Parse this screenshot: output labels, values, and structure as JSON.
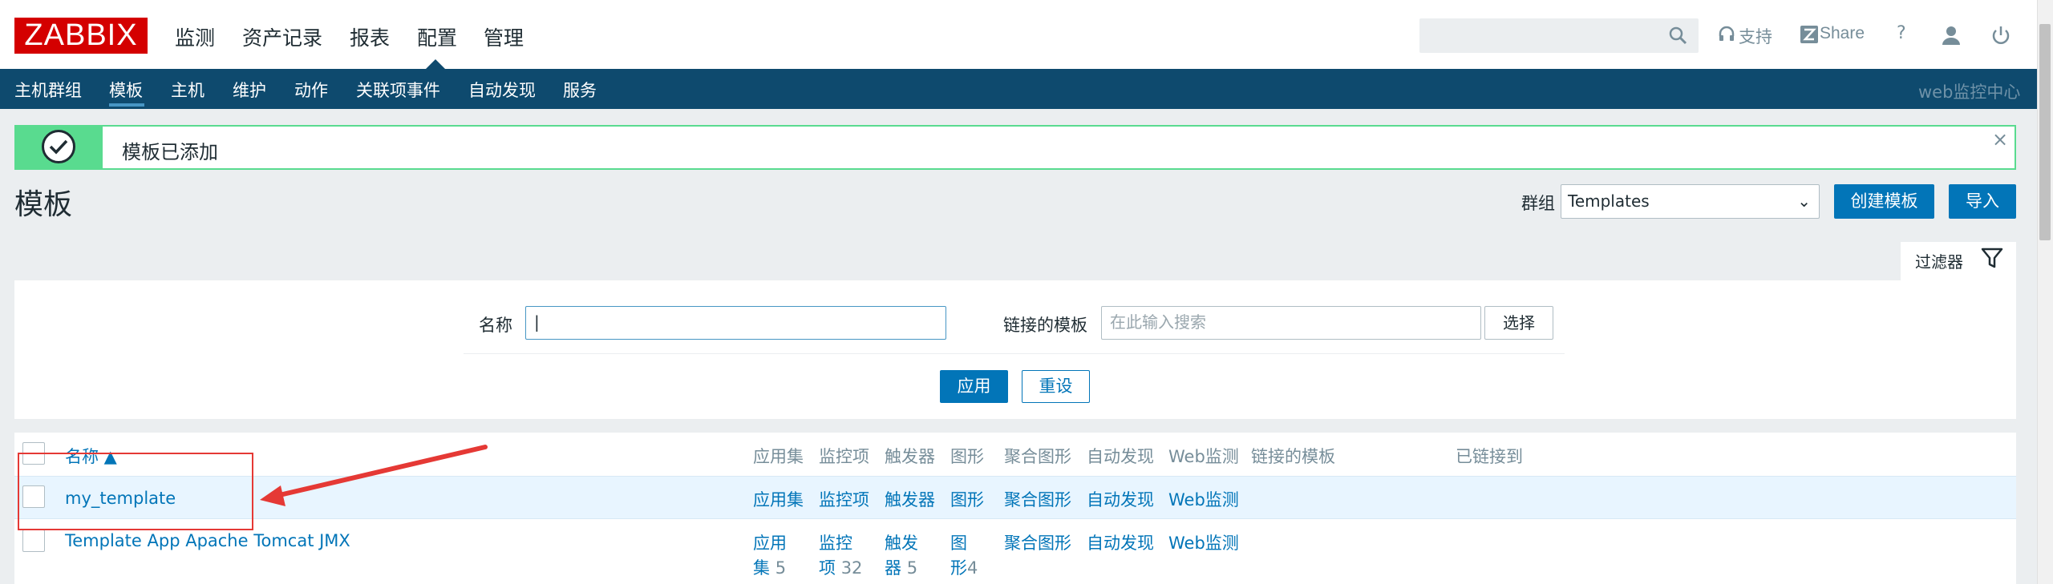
{
  "logo": "ZABBIX",
  "main_nav": [
    "监测",
    "资产记录",
    "报表",
    "配置",
    "管理"
  ],
  "topbar": {
    "support": "支持",
    "share": "Share",
    "help": "?"
  },
  "sub_nav": [
    "主机群组",
    "模板",
    "主机",
    "维护",
    "动作",
    "关联项事件",
    "自动发现",
    "服务"
  ],
  "sub_nav_right": "web监控中心",
  "message": "模板已添加",
  "page_title": "模板",
  "group": {
    "label": "群组",
    "value": "Templates"
  },
  "buttons": {
    "create": "创建模板",
    "import": "导入",
    "select": "选择",
    "apply": "应用",
    "reset": "重设"
  },
  "filter": {
    "tab_label": "过滤器",
    "name_label": "名称",
    "linked_label": "链接的模板",
    "linked_placeholder": "在此输入搜索"
  },
  "table": {
    "headers": [
      "名称 ▲",
      "应用集",
      "监控项",
      "触发器",
      "图形",
      "聚合图形",
      "自动发现",
      "Web监测",
      "链接的模板",
      "已链接到"
    ],
    "rows": [
      {
        "name": "my_template",
        "app": "应用集",
        "items": "监控项",
        "triggers": "触发器",
        "graphs": "图形",
        "screens": "聚合图形",
        "discovery": "自动发现",
        "web": "Web监测"
      },
      {
        "name": "Template App Apache Tomcat JMX",
        "app_1": "应用",
        "app_2": "集",
        "app_n": "5",
        "items_1": "监控",
        "items_2": "项",
        "items_n": "32",
        "triggers_1": "触发",
        "triggers_2": "器",
        "triggers_n": "5",
        "graphs_1": "图",
        "graphs_2": "形",
        "graphs_n": "4",
        "screens": "聚合图形",
        "discovery": "自动发现",
        "web": "Web监测"
      }
    ]
  },
  "colors": {
    "brand": "#d40000",
    "nav": "#0e4a6e",
    "link": "#0275b8",
    "success": "#59db8f",
    "annotation": "#e53935"
  }
}
